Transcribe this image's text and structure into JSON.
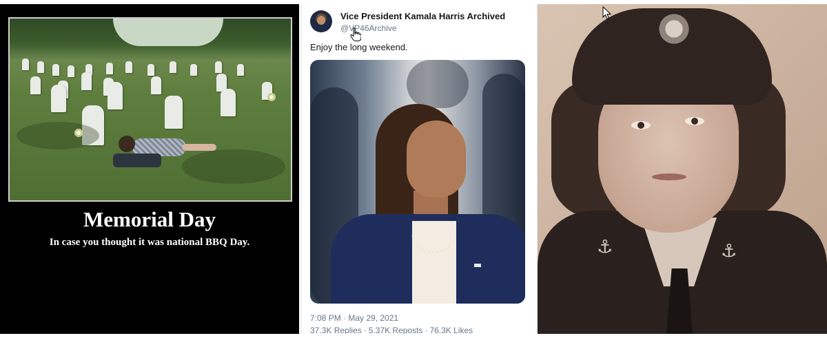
{
  "poster": {
    "title": "Memorial Day",
    "subtitle": "In case you thought it was national BBQ Day."
  },
  "tweet": {
    "display_name": "Vice President Kamala Harris Archived",
    "handle": "@VP46Archive",
    "text": "Enjoy the long weekend.",
    "timestamp": "7:08 PM · May 29, 2021",
    "stats": {
      "replies": "37.3K Replies",
      "reposts": "5.37K Reposts",
      "likes": "76.3K Likes",
      "separator": "·"
    }
  },
  "icons": {
    "cursor_hand": "hand-pointer-icon",
    "cursor_arrow": "arrow-pointer-icon",
    "anchor": "anchor-insignia-icon"
  },
  "colors": {
    "poster_background": "#000000",
    "tweet_text": "#14171a",
    "tweet_meta": "#657786"
  }
}
